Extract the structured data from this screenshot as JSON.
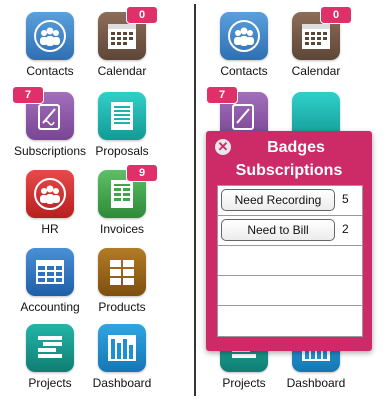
{
  "left": {
    "apps": [
      {
        "label": "Contacts"
      },
      {
        "label": "Calendar",
        "badge": "0"
      },
      {
        "label": "Subscriptions",
        "badge": "7"
      },
      {
        "label": "Proposals"
      },
      {
        "label": "HR"
      },
      {
        "label": "Invoices",
        "badge": "9"
      },
      {
        "label": "Accounting"
      },
      {
        "label": "Products"
      },
      {
        "label": "Projects"
      },
      {
        "label": "Dashboard"
      }
    ]
  },
  "right": {
    "apps": [
      {
        "label": "Contacts"
      },
      {
        "label": "Calendar",
        "badge": "0"
      },
      {
        "badge": "7"
      },
      {
        "label": "Projects"
      },
      {
        "label": "Dashboard"
      }
    ]
  },
  "popup": {
    "title_line1": "Badges",
    "title_line2": "Subscriptions",
    "close_glyph": "✕",
    "rows": [
      {
        "label": "Need Recording",
        "count": "5"
      },
      {
        "label": "Need to Bill",
        "count": "2"
      }
    ]
  },
  "colors": {
    "contacts": "#3f84c6",
    "calendar": "#7a5e4d",
    "subscriptions": "#8d5aa6",
    "proposals": "#1fb3ad",
    "hr": "#d62d2d",
    "invoices": "#3fa64a",
    "accounting": "#2f73c0",
    "products": "#9a6316",
    "projects": "#179c90",
    "dashboard": "#1f8fd0",
    "badge": "#e0306a",
    "popup": "#cc2b67"
  }
}
